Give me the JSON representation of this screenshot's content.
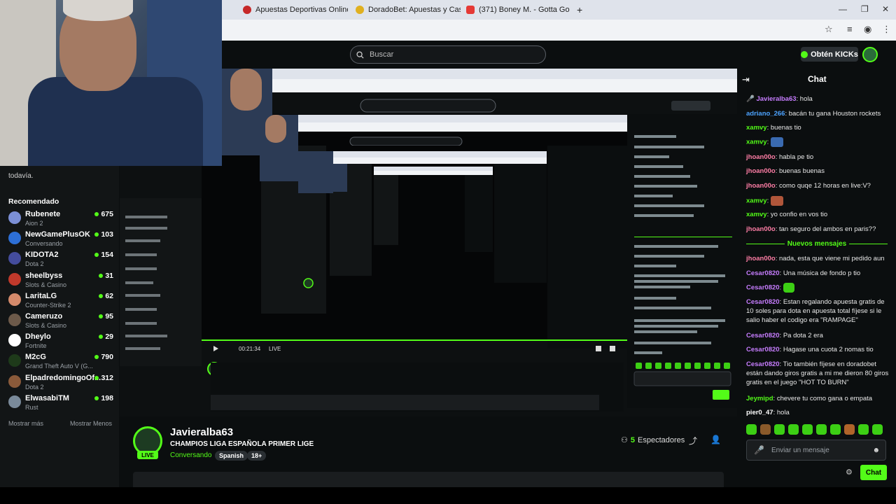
{
  "browser": {
    "tabs": [
      {
        "title": "Apuestas Deportivas Online | A",
        "color": "#c62828"
      },
      {
        "title": "DoradoBet: Apuestas y Casino",
        "color": "#e0b020"
      },
      {
        "title": "(371) Boney M. - Gotta Go",
        "color": "#e53935"
      }
    ],
    "new_tab": "+",
    "win_controls": [
      "—",
      "❐",
      "✕"
    ]
  },
  "kick": {
    "search_placeholder": "Buscar",
    "get_kicks": "Obtén KICKs"
  },
  "sidebar": {
    "top_text": "todavía.",
    "recommended_label": "Recomendado",
    "items": [
      {
        "name": "Rubenete",
        "category": "Aion 2",
        "viewers": "675",
        "color": "#7b8fd6"
      },
      {
        "name": "NewGamePlusOK",
        "category": "Conversando",
        "viewers": "103",
        "color": "#2d6fd6"
      },
      {
        "name": "KIDOTA2",
        "category": "Dota 2",
        "viewers": "154",
        "color": "#444c9c"
      },
      {
        "name": "sheelbyss",
        "category": "Slots & Casino",
        "viewers": "31",
        "color": "#c0392b"
      },
      {
        "name": "LaritaLG",
        "category": "Counter-Strike 2",
        "viewers": "62",
        "color": "#d48a6b"
      },
      {
        "name": "Cameruzo",
        "category": "Slots & Casino",
        "viewers": "95",
        "color": "#6d5a4a"
      },
      {
        "name": "Dheylo",
        "category": "Fortnite",
        "viewers": "29",
        "color": "#ffffff"
      },
      {
        "name": "M2cG",
        "category": "Grand Theft Auto V (G...",
        "viewers": "790",
        "color": "#1e3a1a"
      },
      {
        "name": "ElpadredomingoOf...",
        "category": "Dota 2",
        "viewers": "312",
        "color": "#8a5a3a"
      },
      {
        "name": "ElwasabiTM",
        "category": "Rust",
        "viewers": "198",
        "color": "#7a8a9a"
      }
    ],
    "show_more": "Mostrar más",
    "show_less": "Mostrar Menos"
  },
  "stream": {
    "streamer": "Javieralba63",
    "title": "CHAMPIOS LIGA ESPAÑOLA PRIMER LIGE",
    "category": "Conversando",
    "tags": [
      "Spanish",
      "18+"
    ],
    "live": "LIVE",
    "viewers_count": "5",
    "viewers_label": "Espectadores",
    "player_time": "00:21:34",
    "player_live": "LIVE"
  },
  "chat": {
    "title": "Chat",
    "messages": [
      {
        "user": "Javieralba63",
        "color": "#c77dff",
        "text": ": hola"
      },
      {
        "user": "adriano_266",
        "color": "#4da3ff",
        "text": ": bacán tu gana Houston rockets"
      },
      {
        "user": "xamvy",
        "color": "#53fc18",
        "text": ": buenas tio"
      },
      {
        "user": "xamvy",
        "color": "#53fc18",
        "text": ":"
      },
      {
        "user": "jhoan00o",
        "color": "#ff7ea6",
        "text": ": habla pe tio"
      },
      {
        "user": "jhoan00o",
        "color": "#ff7ea6",
        "text": ": buenas buenas"
      },
      {
        "user": "jhoan00o",
        "color": "#ff7ea6",
        "text": ": como quqe 12 horas en live:V?"
      },
      {
        "user": "xamvy",
        "color": "#53fc18",
        "text": ":"
      },
      {
        "user": "xamvy",
        "color": "#53fc18",
        "text": ": yo confio en vos tio"
      },
      {
        "user": "jhoan00o",
        "color": "#ff7ea6",
        "text": ": tan seguro del ambos en paris??"
      }
    ],
    "new_messages_label": "Nuevos mensajes",
    "messages2": [
      {
        "user": "jhoan00o",
        "color": "#ff7ea6",
        "text": ": nada, esta que viene mi pedido aun"
      },
      {
        "user": "Cesar0820",
        "color": "#c77dff",
        "text": ": Una música de fondo p tio"
      },
      {
        "user": "Cesar0820",
        "color": "#c77dff",
        "text": ":"
      },
      {
        "user": "Cesar0820",
        "color": "#c77dff",
        "text": ": Estan regalando apuesta gratis de 10 soles para dota en apuesta total fíjese si le salio haber el codigo era \"RAMPAGE\""
      },
      {
        "user": "Cesar0820",
        "color": "#c77dff",
        "text": ": Pa dota 2 era"
      },
      {
        "user": "Cesar0820",
        "color": "#c77dff",
        "text": ": Hagase una cuota 2 nomas tio"
      },
      {
        "user": "Cesar0820",
        "color": "#c77dff",
        "text": ": Tio también fíjese en doradobet están dando giros gratis a mi me dieron 80 giros gratis en el juego \"HOT TO BURN\""
      },
      {
        "user": "Jeymipd",
        "color": "#53fc18",
        "text": ": chevere tu como gana o empata"
      },
      {
        "user": "pier0_47",
        "color": "#ffffff",
        "text": ": hola"
      }
    ],
    "input_placeholder": "Enviar un mensaje",
    "send_label": "Chat"
  },
  "colors": {
    "accent": "#53fc18",
    "bg": "#0b0e0f"
  }
}
